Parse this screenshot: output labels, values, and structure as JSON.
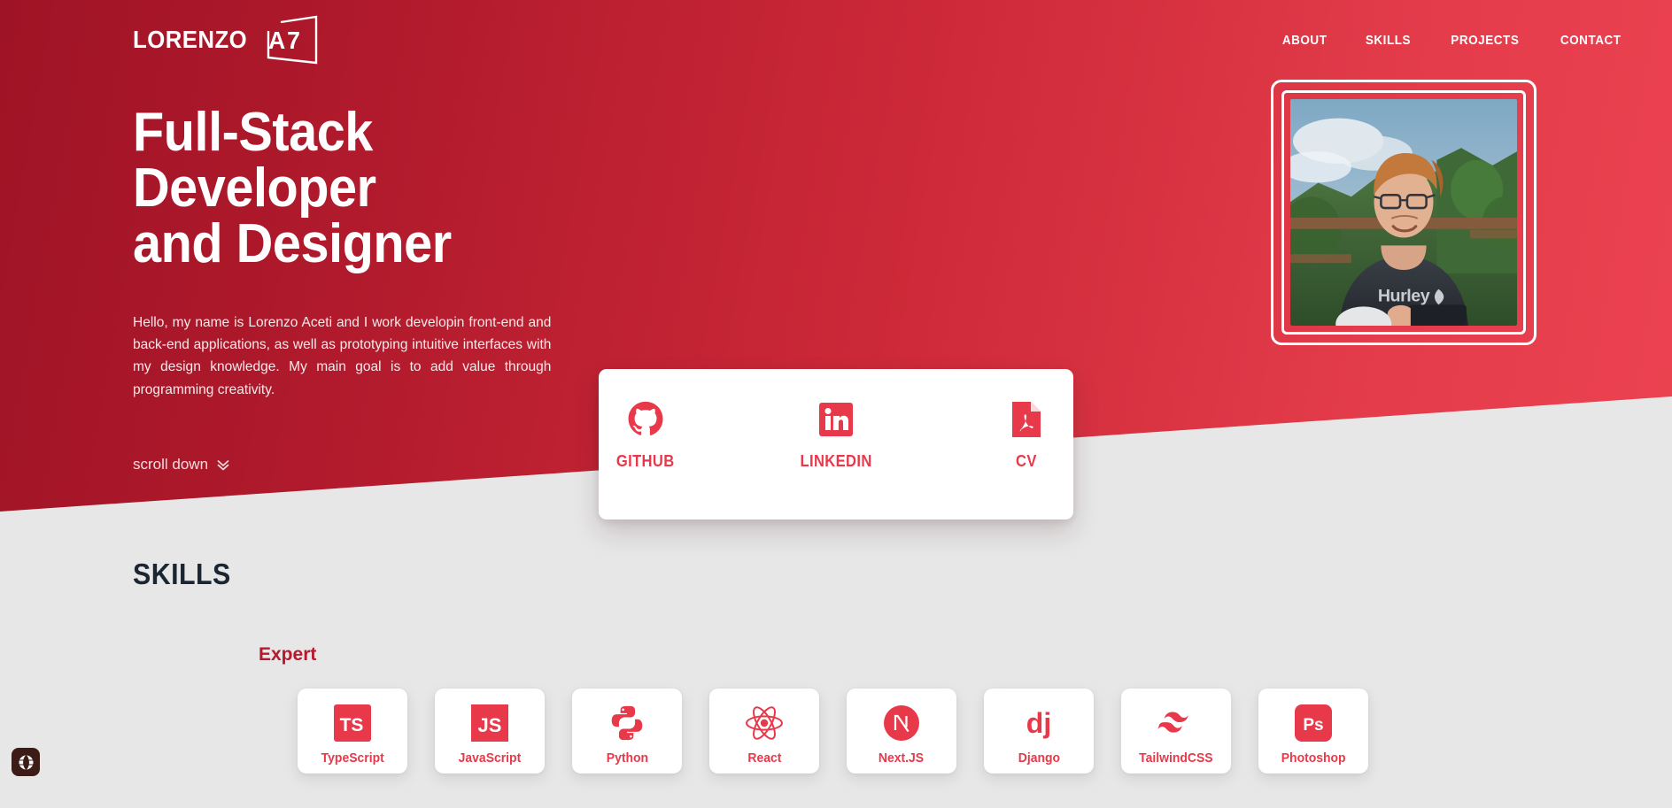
{
  "theme": {
    "red_dark": "#9f1326",
    "red_bright": "#ec4251",
    "accent": "#e8394a",
    "accent_deep": "#b7182c",
    "page_bg": "#e7e7e7",
    "heading_dark": "#1b2633",
    "globe_bg": "#3d1b17"
  },
  "nav": {
    "logo_word": "LORENZO",
    "logo_mark": "A7",
    "links": [
      {
        "label": "ABOUT"
      },
      {
        "label": "SKILLS"
      },
      {
        "label": "PROJECTS"
      },
      {
        "label": "CONTACT"
      }
    ]
  },
  "hero": {
    "title_line1": "Full-Stack Developer",
    "title_line2": "and Designer",
    "paragraph": "Hello, my name is Lorenzo Aceti and I work developin front-end and back-end applications, as well as prototyping intuitive interfaces with my design knowledge. My main goal is to add value through programming creativity.",
    "scroll_label": "scroll down",
    "scroll_icon": "chevron-double-down-icon",
    "photo_alt": "portrait-photo"
  },
  "social_card": {
    "items": [
      {
        "label": "GITHUB",
        "icon": "github-icon"
      },
      {
        "label": "LINKEDIN",
        "icon": "linkedin-icon"
      },
      {
        "label": "CV",
        "icon": "pdf-file-icon"
      }
    ]
  },
  "skills": {
    "section_title": "SKILLS",
    "level_label": "Expert",
    "items": [
      {
        "name": "TypeScript",
        "icon": "typescript-icon"
      },
      {
        "name": "JavaScript",
        "icon": "javascript-icon"
      },
      {
        "name": "Python",
        "icon": "python-icon"
      },
      {
        "name": "React",
        "icon": "react-icon"
      },
      {
        "name": "Next.JS",
        "icon": "nextjs-icon"
      },
      {
        "name": "Django",
        "icon": "django-icon"
      },
      {
        "name": "TailwindCSS",
        "icon": "tailwindcss-icon"
      },
      {
        "name": "Photoshop",
        "icon": "photoshop-icon"
      }
    ]
  },
  "widgets": {
    "translate": {
      "icon": "globe-icon"
    }
  }
}
